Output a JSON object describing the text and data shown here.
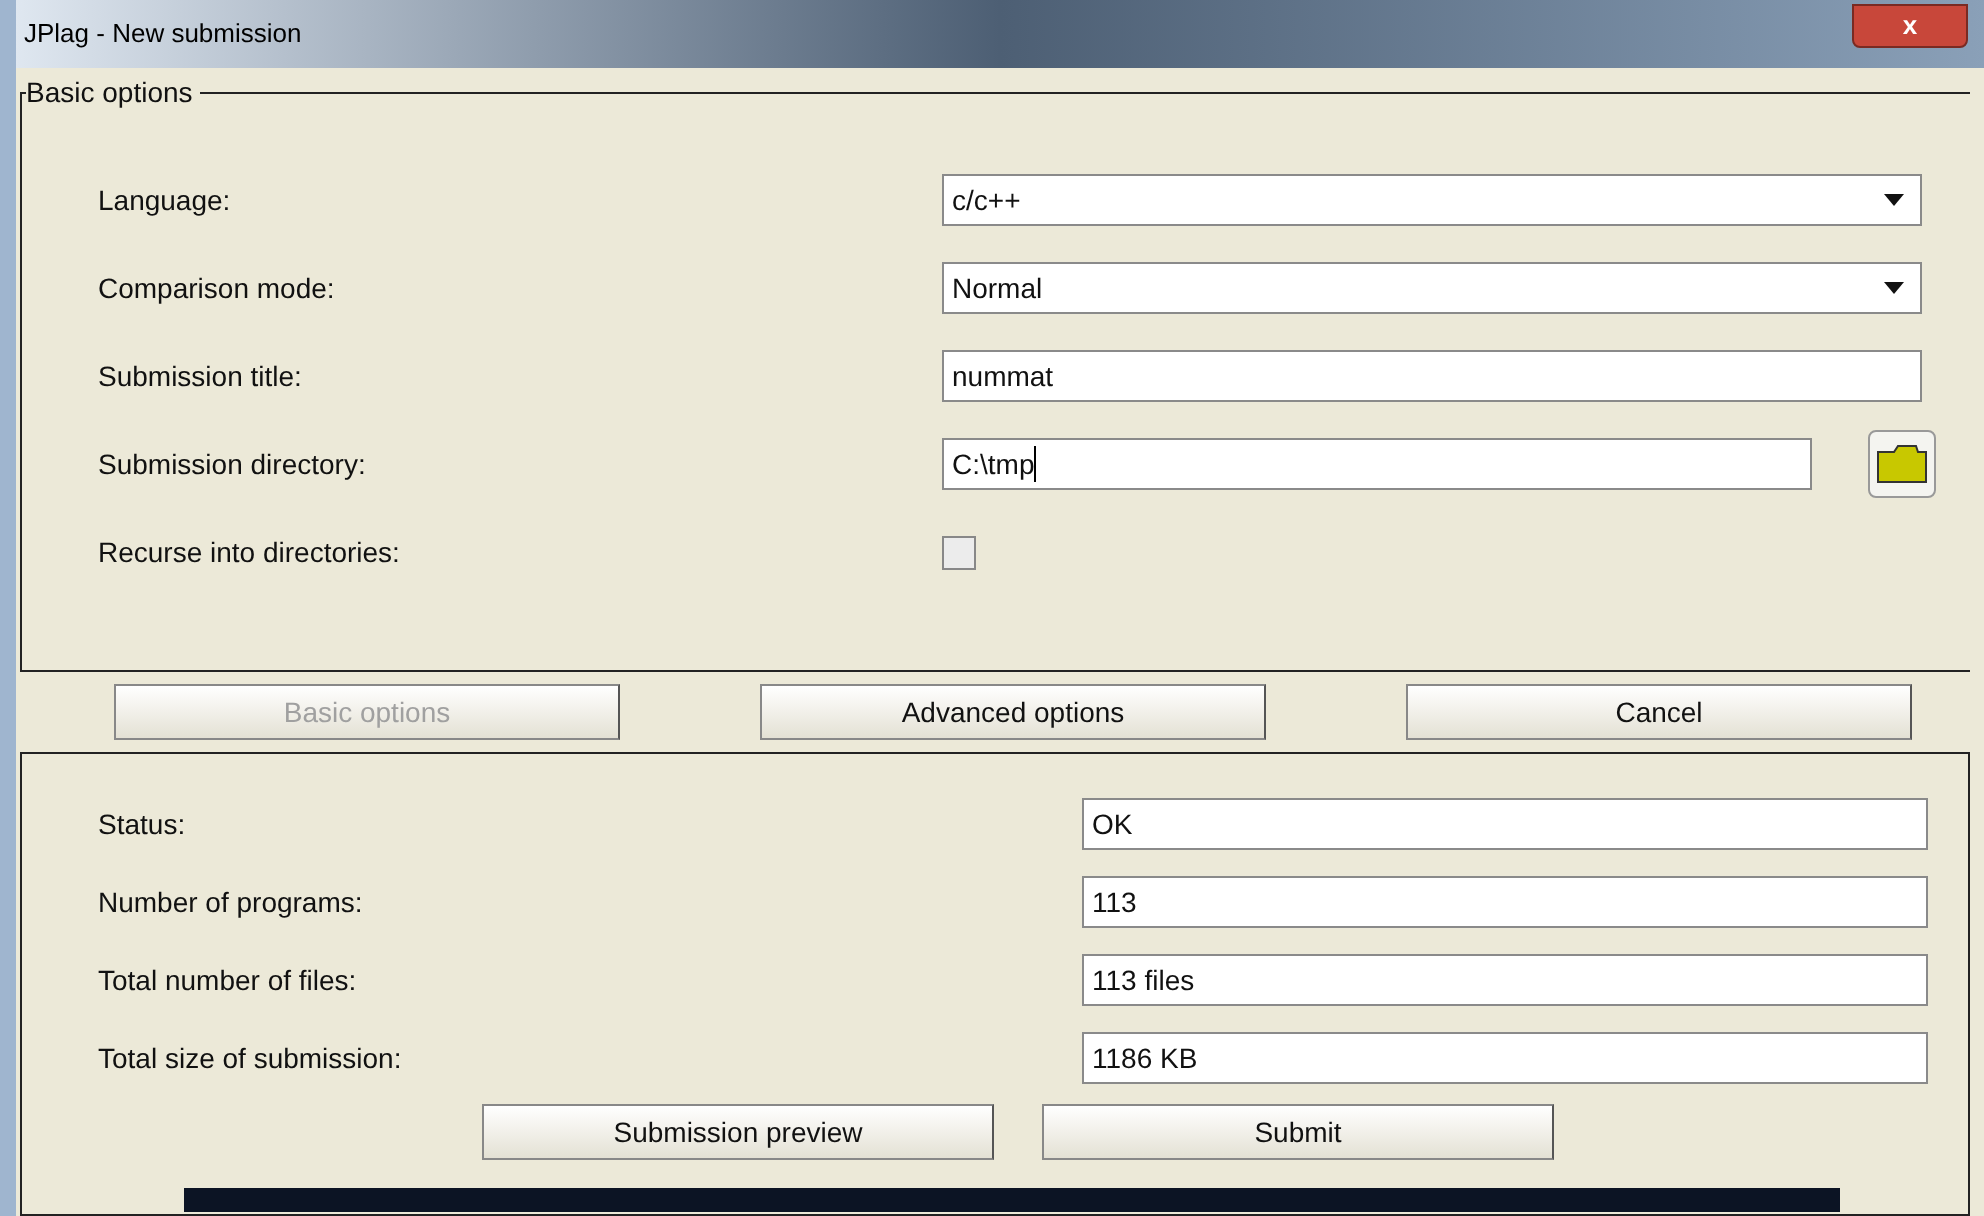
{
  "window": {
    "title": "JPlag - New submission",
    "close": "x"
  },
  "basic_options": {
    "title": "Basic options",
    "fields": [
      {
        "kind": "dropdown",
        "label": "Language:",
        "value": "c/c++"
      },
      {
        "kind": "dropdown",
        "label": "Comparison mode:",
        "value": "Normal"
      },
      {
        "kind": "text",
        "label": "Submission title:",
        "value": "nummat"
      },
      {
        "kind": "directory",
        "label": "Submission directory:",
        "value": "C:\\tmp",
        "focused": true
      },
      {
        "kind": "checkbox",
        "label": "Recurse into directories:",
        "checked": false
      }
    ]
  },
  "nav_buttons": [
    {
      "label": "Basic options",
      "disabled": true
    },
    {
      "label": "Advanced options",
      "disabled": false
    },
    {
      "label": "Cancel",
      "disabled": false
    }
  ],
  "status_fields": [
    {
      "label": "Status:",
      "value": "OK"
    },
    {
      "label": "Number of programs:",
      "value": "113"
    },
    {
      "label": "Total number of files:",
      "value": "113 files"
    },
    {
      "label": "Total size of submission:",
      "value": "1186 KB"
    }
  ],
  "action_buttons": [
    "Submission preview",
    "Submit"
  ]
}
